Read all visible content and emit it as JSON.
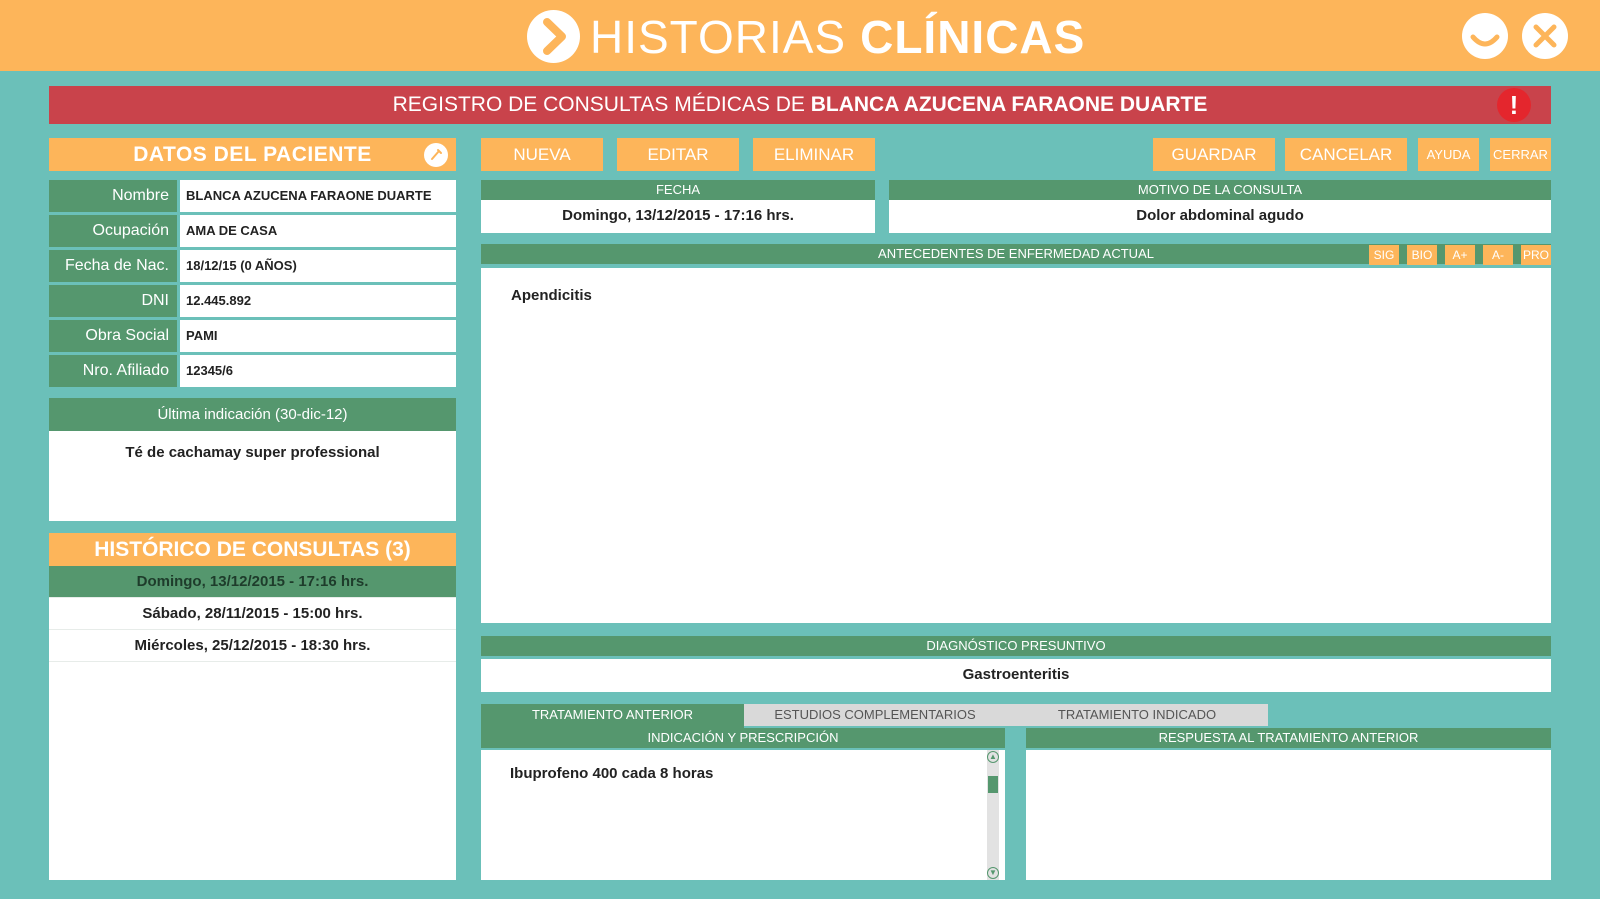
{
  "app": {
    "title_light": "HISTORIAS",
    "title_bold": "CLÍNICAS",
    "icons": {
      "logo": "chevron-right-circle-icon",
      "minimize": "minimize-icon",
      "close": "close-icon"
    }
  },
  "banner": {
    "prefix": "REGISTRO DE CONSULTAS MÉDICAS DE",
    "patient": "BLANCA AZUCENA FARAONE DUARTE",
    "alert": "!"
  },
  "patient": {
    "header": "DATOS DEL PACIENTE",
    "fields": [
      {
        "label": "Nombre",
        "value": "BLANCA AZUCENA FARAONE DUARTE"
      },
      {
        "label": "Ocupación",
        "value": "AMA DE CASA"
      },
      {
        "label": "Fecha de Nac.",
        "value": "18/12/15 (0 AÑOS)"
      },
      {
        "label": "DNI",
        "value": "12.445.892"
      },
      {
        "label": "Obra Social",
        "value": "PAMI"
      },
      {
        "label": "Nro. Afiliado",
        "value": "12345/6"
      }
    ],
    "last_indication_label": "Última indicación (30-dic-12)",
    "last_indication_text": "Té de cachamay super professional"
  },
  "history": {
    "header": "HISTÓRICO DE CONSULTAS (3)",
    "items": [
      "Domingo, 13/12/2015 - 17:16 hrs.",
      "Sábado, 28/11/2015 - 15:00 hrs.",
      "Miércoles, 25/12/2015 - 18:30 hrs."
    ],
    "selected_index": 0
  },
  "toolbar": {
    "nueva": "NUEVA",
    "editar": "EDITAR",
    "eliminar": "ELIMINAR",
    "guardar": "GUARDAR",
    "cancelar": "CANCELAR",
    "ayuda": "AYUDA",
    "cerrar": "CERRAR"
  },
  "consulta": {
    "fecha_label": "FECHA",
    "fecha_value": "Domingo, 13/12/2015 - 17:16 hrs.",
    "motivo_label": "MOTIVO DE LA CONSULTA",
    "motivo_value": "Dolor abdominal agudo",
    "antecedentes_label": "ANTECEDENTES DE ENFERMEDAD ACTUAL",
    "antecedentes_buttons": [
      "SIG",
      "BIO",
      "A+",
      "A-",
      "PRO"
    ],
    "antecedentes_value": "Apendicitis",
    "diagnostico_label": "DIAGNÓSTICO PRESUNTIVO",
    "diagnostico_value": "Gastroenteritis"
  },
  "tabs": [
    "TRATAMIENTO ANTERIOR",
    "ESTUDIOS COMPLEMENTARIOS",
    "TRATAMIENTO INDICADO"
  ],
  "treatment": {
    "indicacion_label": "INDICACIÓN Y PRESCRIPCIÓN",
    "indicacion_value": "Ibuprofeno 400 cada 8 horas",
    "respuesta_label": "RESPUESTA AL TRATAMIENTO ANTERIOR",
    "respuesta_value": ""
  },
  "colors": {
    "orange": "#fdb55a",
    "teal_background": "#6bc0b9",
    "green": "#55976e",
    "banner_red": "#c9434b",
    "alert_red": "#e4262d"
  }
}
